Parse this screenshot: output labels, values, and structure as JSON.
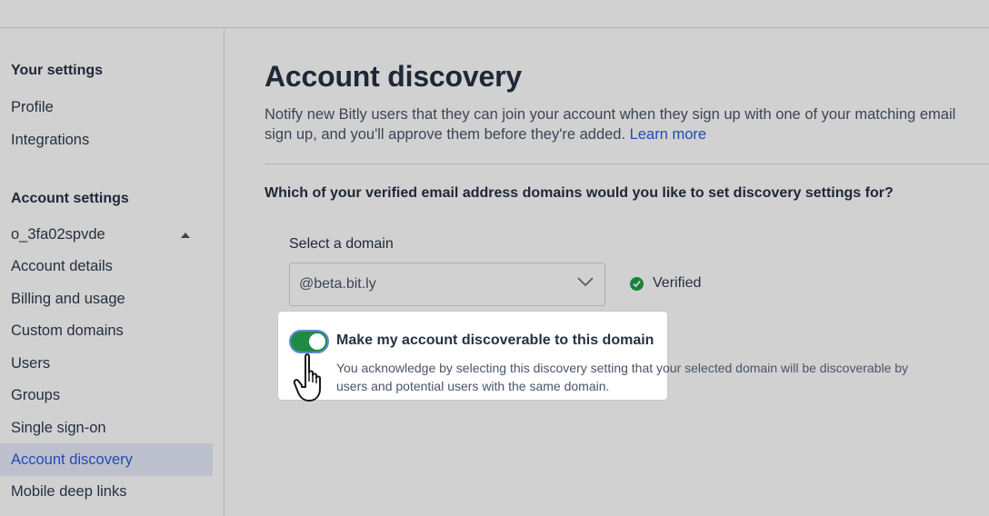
{
  "sidebar": {
    "your_settings_heading": "Your settings",
    "your_settings_items": [
      "Profile",
      "Integrations"
    ],
    "account_settings_heading": "Account settings",
    "org_name": "o_3fa02spvde",
    "account_items": [
      "Account details",
      "Billing and usage",
      "Custom domains",
      "Users",
      "Groups",
      "Single sign-on",
      "Account discovery",
      "Mobile deep links"
    ],
    "active_item": "Account discovery"
  },
  "main": {
    "title": "Account discovery",
    "description_line1": "Notify new Bitly users that they can join your account when they sign up with one of your matching email",
    "description_line2": "sign up, and you'll approve them before they're added.",
    "learn_more": "Learn more",
    "question": "Which of your verified email address domains would you like to set discovery settings for?",
    "select_label": "Select a domain",
    "select_value": "@beta.bit.ly",
    "verified_label": "Verified",
    "toggle": {
      "title": "Make my account discoverable to this domain",
      "description_line1": "You acknowledge by selecting this discovery setting that your selected domain will be discoverable by",
      "description_line2": "users and potential users with the same domain.",
      "on": true
    }
  },
  "colors": {
    "accent": "#2a5bd7",
    "toggle_on": "#1f8a43",
    "verified": "#1e9e4a",
    "dim_overlay": "rgba(0,0,0,0.18)"
  },
  "icons": [
    "caret-up-icon",
    "chevron-down-icon",
    "check-circle-icon",
    "hand-pointer-icon"
  ]
}
